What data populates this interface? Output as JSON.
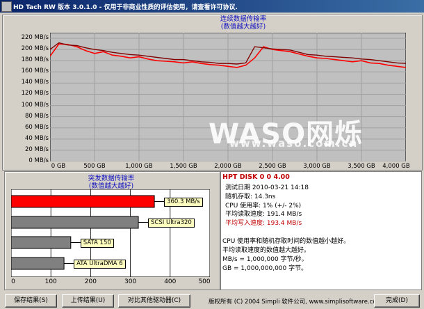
{
  "window": {
    "title": "HD Tach RW 版本 3.0.1.0 - 仅用于非商业性质的评估使用，请查看许可协议."
  },
  "sequential": {
    "caption_line1": "连续数据传输率",
    "caption_line2": "(数值越大越好)",
    "y_ticks": [
      "220 MB/s",
      "200 MB/s",
      "180 MB/s",
      "160 MB/s",
      "140 MB/s",
      "120 MB/s",
      "100 MB/s",
      "80 MB/s",
      "60 MB/s",
      "40 MB/s",
      "20 MB/s",
      "0 MB/s"
    ],
    "x_ticks": [
      "0 GB",
      "500 GB",
      "1,000 GB",
      "1,500 GB",
      "2,000 GB",
      "2,500 GB",
      "3,000 GB",
      "3,500 GB",
      "4,000 GB"
    ],
    "colors": {
      "read": "#800000",
      "write": "#ff0000"
    }
  },
  "chart_data": {
    "type": "line",
    "xlabel": "",
    "ylabel": "",
    "xlim": [
      0,
      4000
    ],
    "ylim": [
      0,
      230
    ],
    "x": [
      0,
      100,
      200,
      300,
      400,
      500,
      600,
      700,
      800,
      900,
      1000,
      1100,
      1200,
      1300,
      1400,
      1500,
      1600,
      1700,
      1800,
      1900,
      2000,
      2100,
      2200,
      2300,
      2400,
      2500,
      2600,
      2700,
      2800,
      2900,
      3000,
      3100,
      3200,
      3300,
      3400,
      3500,
      3600,
      3700,
      3800,
      3900,
      4000
    ],
    "series": [
      {
        "values": [
          200,
          212,
          208,
          207,
          203,
          200,
          198,
          195,
          193,
          191,
          190,
          188,
          186,
          184,
          182,
          182,
          180,
          178,
          177,
          175,
          175,
          174,
          176,
          205,
          203,
          201,
          200,
          199,
          195,
          191,
          190,
          188,
          187,
          186,
          185,
          183,
          182,
          180,
          178,
          176,
          175
        ]
      },
      {
        "values": [
          188,
          210,
          209,
          205,
          198,
          193,
          196,
          190,
          188,
          185,
          187,
          183,
          180,
          179,
          178,
          176,
          178,
          175,
          173,
          172,
          170,
          168,
          172,
          185,
          205,
          200,
          198,
          196,
          192,
          188,
          185,
          184,
          182,
          180,
          178,
          180,
          176,
          175,
          172,
          170,
          168
        ]
      }
    ]
  },
  "burst": {
    "caption_line1": "突发数据传输率",
    "caption_line2": "(数值越大越好)",
    "x_ticks": [
      "0",
      "100",
      "200",
      "300",
      "400",
      "500"
    ],
    "bars": [
      {
        "label": "360.3 MB/s",
        "value": 360.3,
        "color": "#ff0000"
      },
      {
        "label": "SCSI Ultra320",
        "value": 320,
        "color": "#808080"
      },
      {
        "label": "SATA 150",
        "value": 150,
        "color": "#808080"
      },
      {
        "label": "ATA UltraDMA 6",
        "value": 133,
        "color": "#808080"
      }
    ]
  },
  "info": {
    "title": "HPT DISK 0 0 4.00",
    "test_date": "测试日期 2010-03-21   14:18",
    "random_access": "随机存取: 14.3ns",
    "cpu": "CPU 使用率: 1% (+/- 2%)",
    "avg_read": "平均读取速度: 191.4 MB/s",
    "avg_write": "平均写入速度: 193.4 MB/s",
    "note1": "CPU 使用率和随机存取时间的数值越小越好。",
    "note2": "平均读取速度的数值越大越好。",
    "note3": "MB/s = 1,000,000 字节/秒。",
    "note4": "GB = 1,000,000,000 字节。"
  },
  "buttons": {
    "save": "保存结果(S)",
    "upload": "上传结果(U)",
    "compare": "对比其他驱动器(C)",
    "done": "完成(D)"
  },
  "footer": "版权所有 (C) 2004 Simpli 软件公司, www.simplisoftware.com",
  "watermark": {
    "brand": "WASO网烁",
    "url": "www.waso.com.cn"
  }
}
